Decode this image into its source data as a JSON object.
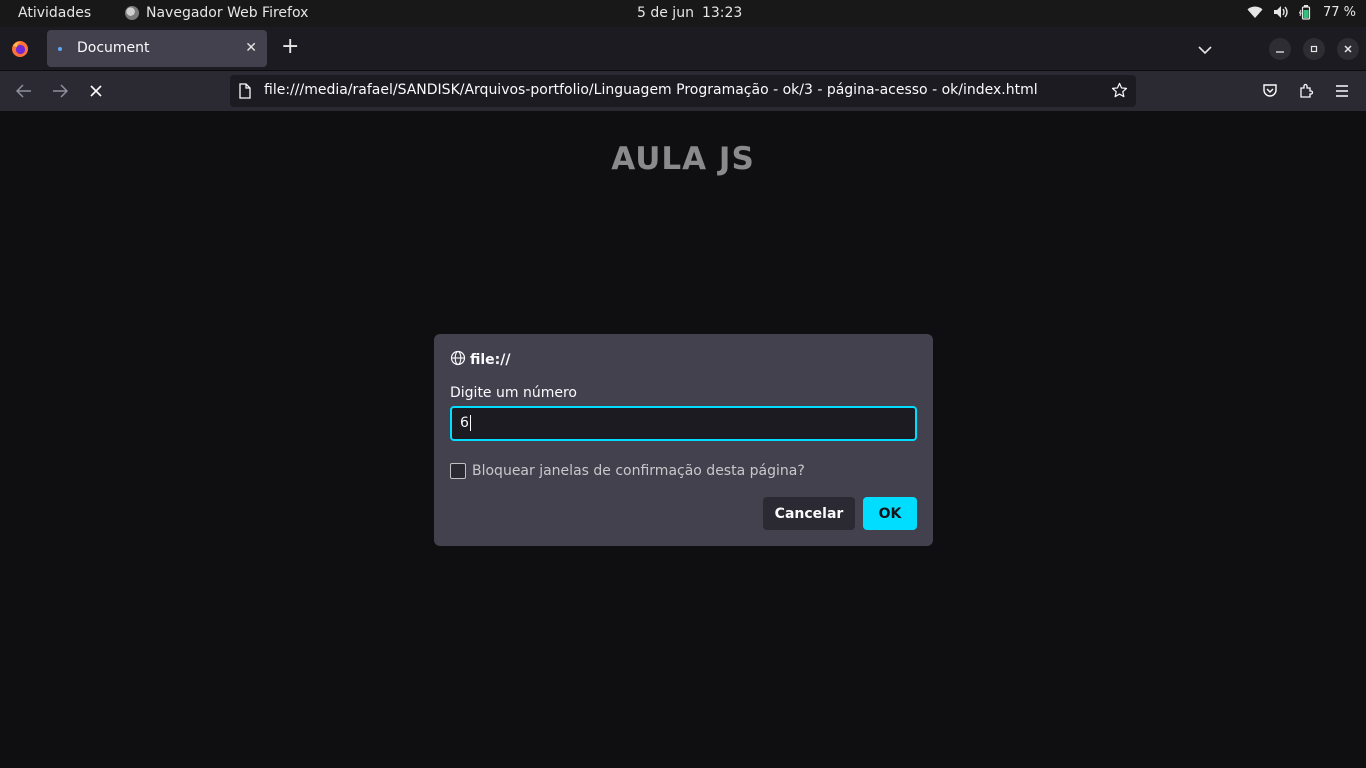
{
  "system_bar": {
    "activities_label": "Atividades",
    "app_name": "Navegador Web Firefox",
    "date": "5 de jun",
    "time": "13:23",
    "battery_percent": "77 %"
  },
  "browser": {
    "tab_title": "Document",
    "url": "file:///media/rafael/SANDISK/Arquivos-portfolio/Linguagem Programação - ok/3 - página-acesso - ok/index.html"
  },
  "page": {
    "heading": "AULA JS"
  },
  "dialog": {
    "origin": "file://",
    "prompt_label": "Digite um número",
    "input_value": "6",
    "checkbox_label": "Bloquear janelas de confirmação desta página?",
    "cancel_label": "Cancelar",
    "ok_label": "OK"
  },
  "colors": {
    "accent": "#00ddff",
    "dialog_bg": "#42414d",
    "page_bg": "#0f0f11"
  }
}
